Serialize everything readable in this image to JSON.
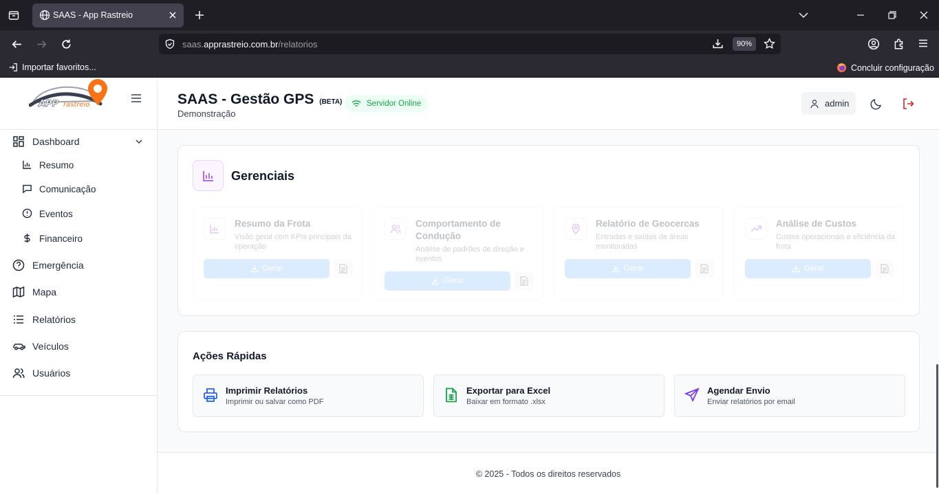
{
  "browser": {
    "tab_title": "SAAS - App Rastreio",
    "url_host_prefix": "saas.",
    "url_host": "apprastreio.com.br",
    "url_path": "/relatorios",
    "zoom": "90%",
    "bookmark_import": "Importar favoritos...",
    "bookmark_setup": "Concluir configuração"
  },
  "sidebar": {
    "logo_text": "APP rastreio",
    "items": [
      {
        "label": "Dashboard",
        "icon": "dashboard-grid-icon"
      },
      {
        "label": "Resumo",
        "icon": "bar-chart-icon"
      },
      {
        "label": "Comunicação",
        "icon": "message-icon"
      },
      {
        "label": "Eventos",
        "icon": "alert-circle-icon"
      },
      {
        "label": "Financeiro",
        "icon": "dollar-icon"
      },
      {
        "label": "Emergência",
        "icon": "help-circle-icon"
      },
      {
        "label": "Mapa",
        "icon": "map-icon"
      },
      {
        "label": "Relatórios",
        "icon": "list-icon"
      },
      {
        "label": "Veículos",
        "icon": "car-icon"
      },
      {
        "label": "Usuários",
        "icon": "users-icon"
      }
    ]
  },
  "header": {
    "title": "SAAS - Gestão GPS",
    "beta": "(BETA)",
    "subtitle": "Demonstração",
    "status": "Servidor Online",
    "user": "admin"
  },
  "reports": {
    "section_title": "Gerenciais",
    "generate_label": "Gerar",
    "cards": [
      {
        "name": "Resumo da Frota",
        "desc": "Visão geral com KPIs principais da operação"
      },
      {
        "name": "Comportamento de Condução",
        "desc": "Análise de padrões de direção e eventos"
      },
      {
        "name": "Relatório de Geocercas",
        "desc": "Entradas e saídas de áreas monitoradas"
      },
      {
        "name": "Análise de Custos",
        "desc": "Custos operacionais e eficiência da frota"
      }
    ]
  },
  "quick_actions": {
    "title": "Ações Rápidas",
    "items": [
      {
        "name": "Imprimir Relatórios",
        "desc": "Imprimir ou salvar como PDF",
        "color": "#2563eb"
      },
      {
        "name": "Exportar para Excel",
        "desc": "Baixar em formato .xlsx",
        "color": "#16a34a"
      },
      {
        "name": "Agendar Envio",
        "desc": "Enviar relatórios por email",
        "color": "#7c3aed"
      }
    ]
  },
  "footer": {
    "text": "© 2025 - Todos os direitos reservados"
  }
}
